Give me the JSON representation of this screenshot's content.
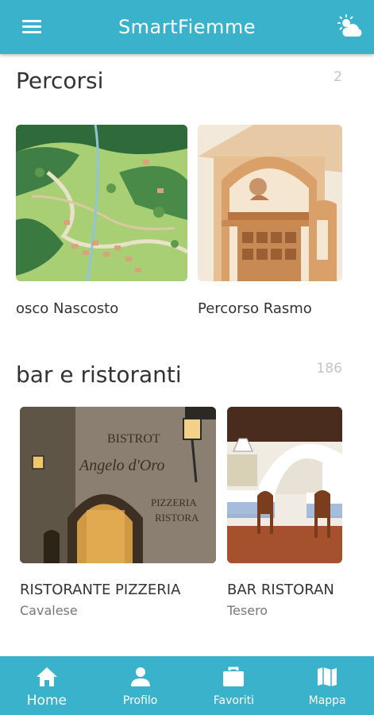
{
  "app": {
    "title": "SmartFiemme"
  },
  "header": {
    "menu_icon": "menu-icon",
    "weather_icon": "weather-partly-cloudy-icon"
  },
  "sections": [
    {
      "title": "Percorsi",
      "count": "2",
      "cards": [
        {
          "title": "osco Nascosto"
        },
        {
          "title": "Percorso Rasmo"
        }
      ]
    },
    {
      "title": "bar e ristoranti",
      "count": "186",
      "cards": [
        {
          "title": "RISTORANTE PIZZERIA",
          "subtitle": "Cavalese",
          "sign_lines": [
            "BISTROT",
            "Angelo d'Oro",
            "PIZZERIA",
            "RISTORA"
          ]
        },
        {
          "title": "BAR RISTORAN",
          "subtitle": "Tesero"
        }
      ]
    }
  ],
  "nav": [
    {
      "label": "Home",
      "icon": "home-icon",
      "active": true
    },
    {
      "label": "Profilo",
      "icon": "person-icon"
    },
    {
      "label": "Favoriti",
      "icon": "briefcase-icon"
    },
    {
      "label": "Mappa",
      "icon": "map-icon"
    }
  ],
  "colors": {
    "primary": "#3bb2cc",
    "text": "#333333",
    "muted": "#c4c4c4"
  }
}
